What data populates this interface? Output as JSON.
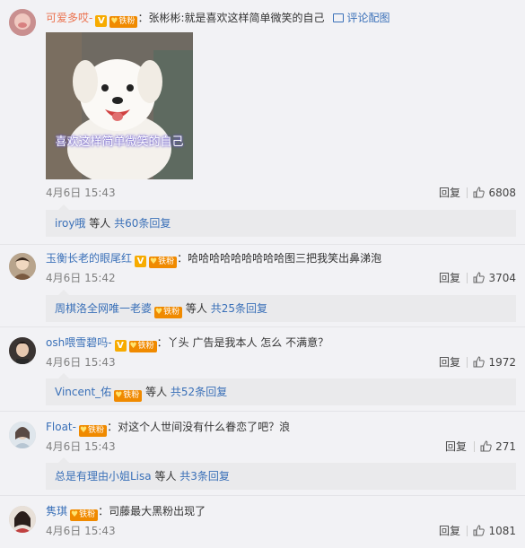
{
  "comments": [
    {
      "username": "可爱多哎-",
      "text": "：张彬彬:就是喜欢这样简单微笑的自己",
      "pic_mark": "评论配图",
      "pic_caption": "喜欢这样简单微笑的自己",
      "time": "4月6日 15:43",
      "reply": "回复",
      "likes": "6808",
      "sub_user": "iroy哦",
      "sub_mid": " 等人 ",
      "sub_more": "共60条回复"
    },
    {
      "username": "玉衡长老的眼尾红",
      "text": "：哈哈哈哈哈哈哈哈哈图三把我笑出鼻涕泡",
      "time": "4月6日 15:42",
      "reply": "回复",
      "likes": "3704",
      "sub_user": "周棋洛全网唯一老婆",
      "sub_mid": " 等人 ",
      "sub_more": "共25条回复"
    },
    {
      "username": "osh喂雪碧吗-",
      "text": "：丫头 广告是我本人 怎么 不满意？",
      "time": "4月6日 15:43",
      "reply": "回复",
      "likes": "1972",
      "sub_user": "Vincent_佑",
      "sub_mid": " 等人 ",
      "sub_more": "共52条回复"
    },
    {
      "username": "Float-",
      "text": "：对这个人世间没有什么眷恋了吧？浪",
      "time": "4月6日 15:43",
      "reply": "回复",
      "likes": "271",
      "sub_user": "总是有理由小姐Lisa",
      "sub_mid": " 等人 ",
      "sub_more": "共3条回复"
    },
    {
      "username": "隽琪",
      "text": "：司藤最大黑粉出现了",
      "time": "4月6日 15:43",
      "reply": "回复",
      "likes": "1081"
    }
  ],
  "badges": {
    "v": "V",
    "fan": "铁粉"
  },
  "colors": {
    "username": "#eb7350",
    "link": "#3a70b8",
    "badge_v": "#f7ab00",
    "badge_fan": "#f08a00"
  }
}
